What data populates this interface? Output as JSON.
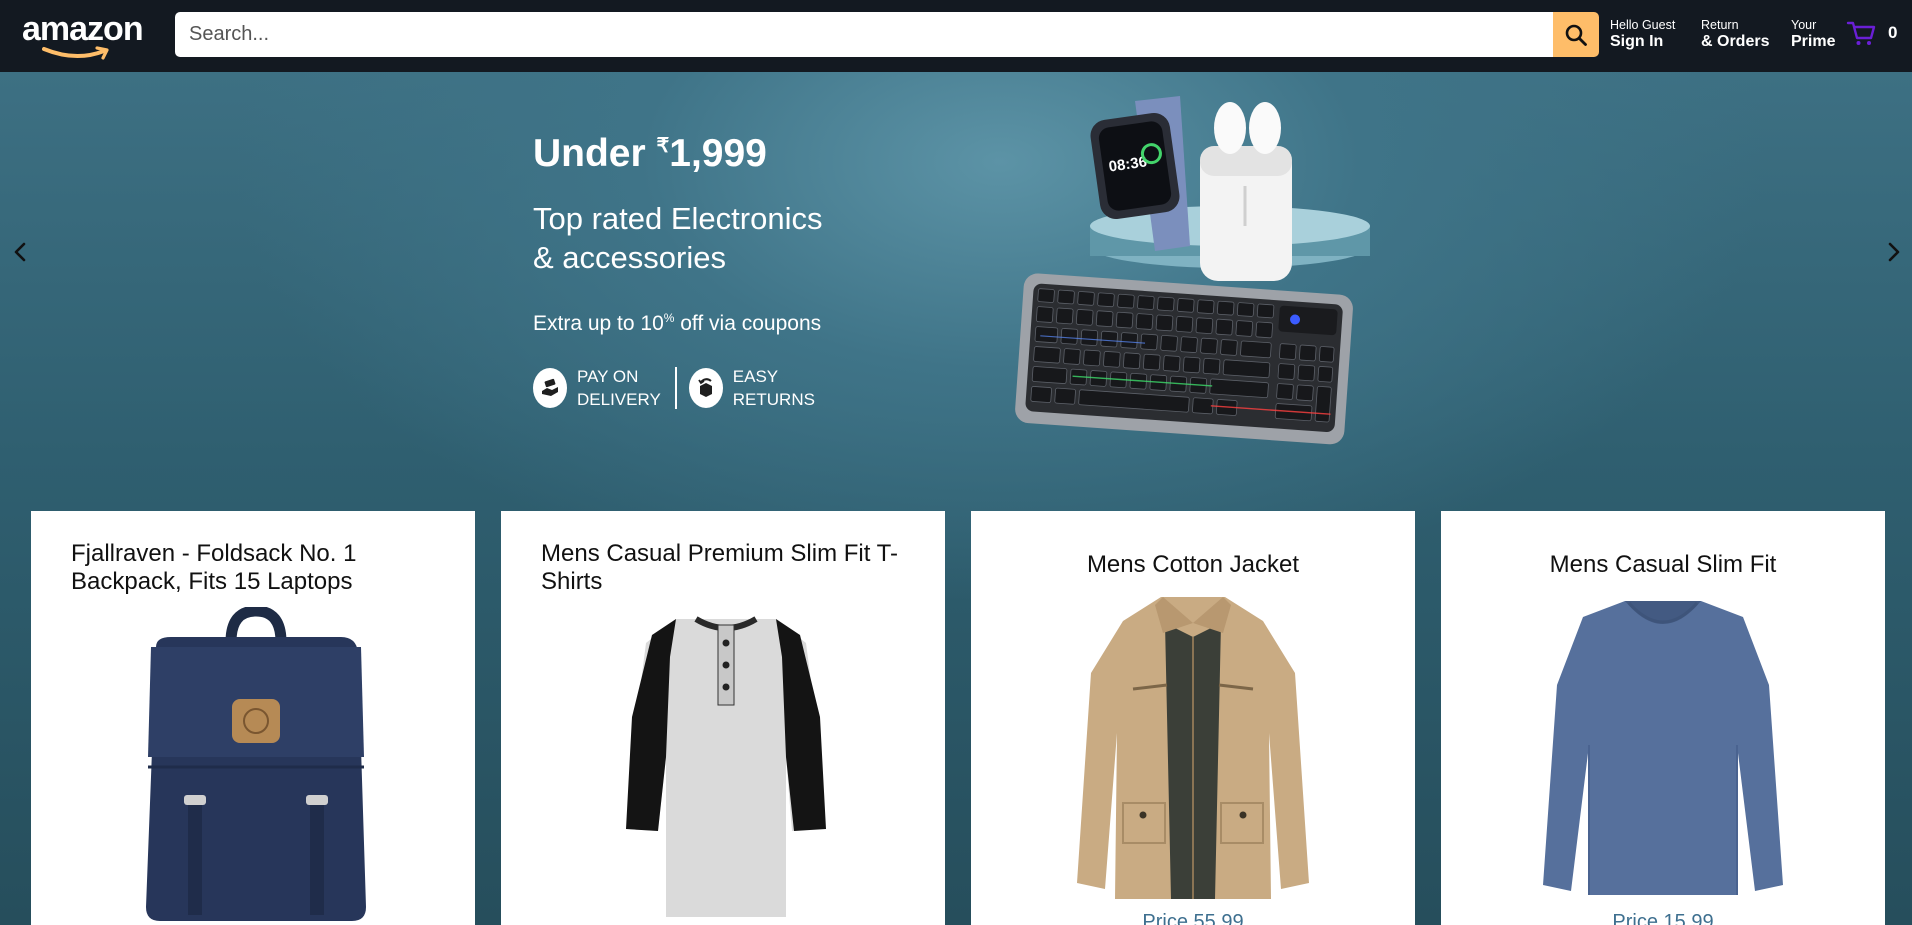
{
  "header": {
    "logo_text": "amazon",
    "search_placeholder": "Search...",
    "signin": {
      "line1": "Hello Guest",
      "line2": "Sign In"
    },
    "orders": {
      "line1": "Return",
      "line2": "& Orders"
    },
    "prime": {
      "line1": "Your",
      "line2": "Prime"
    },
    "cart_count": "0",
    "accent_color": "#febd69",
    "cart_color": "#6a1fd6"
  },
  "hero": {
    "title_prefix": "Under ",
    "currency": "₹",
    "title_amount": "1,999",
    "subtitle_line1": "Top rated Electronics",
    "subtitle_line2": "& accessories",
    "offer_prefix": "Extra up to 10",
    "offer_sup": "%",
    "offer_suffix": " off via coupons",
    "badge1_line1": "PAY ON",
    "badge1_line2": "DELIVERY",
    "badge2_line1": "EASY",
    "badge2_line2": "RETURNS"
  },
  "products": [
    {
      "title": "Fjallraven - Foldsack No. 1 Backpack, Fits 15 Laptops",
      "image": "navy-backpack"
    },
    {
      "title": "Mens Casual Premium Slim Fit T-Shirts",
      "image": "raglan-henley-shirt"
    },
    {
      "title": "Mens Cotton Jacket",
      "image": "khaki-jacket",
      "price": "Price 55.99"
    },
    {
      "title": "Mens Casual Slim Fit",
      "image": "blue-long-sleeve-shirt",
      "price": "Price 15.99"
    }
  ]
}
